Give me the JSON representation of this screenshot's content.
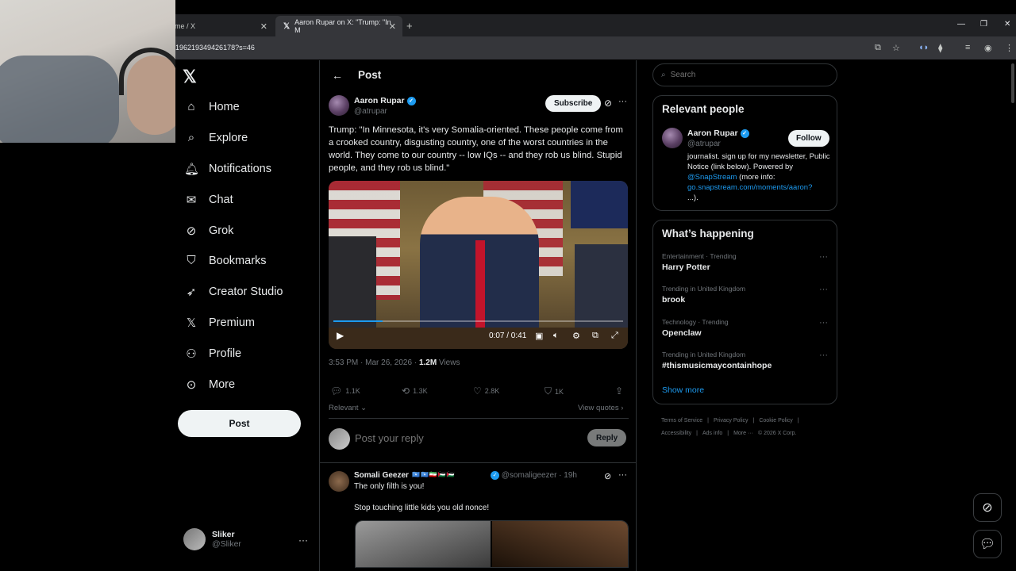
{
  "browser": {
    "tabs": [
      {
        "title": "me / X"
      },
      {
        "title": "Aaron Rupar on X: \"Trump: \"In M"
      }
    ],
    "url": "196219349426178?s=46"
  },
  "nav": {
    "items": [
      {
        "label": "Home",
        "icon": "home-icon"
      },
      {
        "label": "Explore",
        "icon": "search-icon"
      },
      {
        "label": "Notifications",
        "icon": "bell-icon"
      },
      {
        "label": "Chat",
        "icon": "mail-icon"
      },
      {
        "label": "Grok",
        "icon": "grok-icon"
      },
      {
        "label": "Bookmarks",
        "icon": "bookmark-icon"
      },
      {
        "label": "Creator Studio",
        "icon": "rocket-icon"
      },
      {
        "label": "Premium",
        "icon": "x-icon"
      },
      {
        "label": "Profile",
        "icon": "person-icon"
      },
      {
        "label": "More",
        "icon": "more-circle-icon"
      }
    ],
    "post_label": "Post",
    "account": {
      "name": "Sliker",
      "handle": "@Sliker"
    }
  },
  "post": {
    "header_title": "Post",
    "author": {
      "name": "Aaron Rupar",
      "handle": "@atrupar"
    },
    "subscribe_label": "Subscribe",
    "text": "Trump: \"In Minnesota, it's very Somalia-oriented. These people come from a crooked country, disgusting country, one of the worst countries in the world. They come to our country -- low IQs -- and they rob us blind. Stupid people, and they rob us blind.\"",
    "video": {
      "time": "0:07 / 0:41",
      "progress": 0.17
    },
    "timestamp": "3:53 PM · Mar 26, 2026 · ",
    "views_count": "1.2M",
    "views_label": " Views",
    "stats": {
      "replies": "1.1K",
      "reposts": "1.3K",
      "likes": "2.8K",
      "bookmarks": "1K"
    },
    "sort_label": "Relevant",
    "view_quotes_label": "View quotes",
    "reply_placeholder": "Post your reply",
    "reply_label": "Reply"
  },
  "reply": {
    "name": "Somali Geezer",
    "flags": "🇸🇴🇸🇴🇮🇷🇵🇸🇵🇸",
    "handle": "@somaligeezer · 19h",
    "line1": "The only filth is you!",
    "line2": "Stop touching little kids you old nonce!"
  },
  "sidebar": {
    "search_placeholder": "Search",
    "relevant_title": "Relevant people",
    "person": {
      "name": "Aaron Rupar",
      "handle": "@atrupar",
      "follow_label": "Follow",
      "bio_1": "journalist. sign up for my newsletter, Public Notice (link below). Powered by ",
      "bio_link1": "@SnapStream",
      "bio_2": " (more info: ",
      "bio_link2": "go.snapstream.com/moments/aaron?",
      "bio_3": "...)."
    },
    "happening_title": "What’s happening",
    "trends": [
      {
        "context": "Entertainment · Trending",
        "name": "Harry Potter"
      },
      {
        "context": "Trending in United Kingdom",
        "name": "brook"
      },
      {
        "context": "Technology · Trending",
        "name": "Openclaw"
      },
      {
        "context": "Trending in United Kingdom",
        "name": "#thismusicmaycontainhope"
      }
    ],
    "show_more": "Show more",
    "footer": [
      "Terms of Service",
      "|",
      "Privacy Policy",
      "|",
      "Cookie Policy",
      "|",
      "Accessibility",
      "|",
      "Ads info",
      "|",
      "More ···",
      "© 2026 X Corp."
    ]
  },
  "colors": {
    "accent": "#1d9bf0",
    "background": "#000000",
    "border": "#2f3336"
  }
}
